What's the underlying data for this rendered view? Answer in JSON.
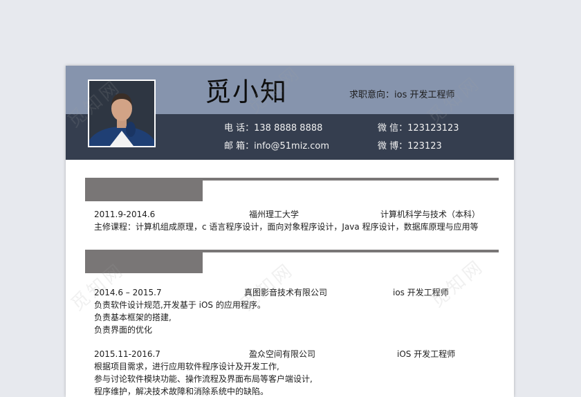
{
  "header": {
    "name": "觅小知",
    "job_intent": "求职意向：ios 开发工程师",
    "phone": "电  话：138 8888 8888",
    "email": "邮  箱：info@51miz.com",
    "wechat": "微  信：123123123",
    "weibo": "微  博：123123"
  },
  "education": {
    "period": "2011.9-2014.6",
    "school": "福州理工大学",
    "major": "计算机科学与技术（本科）",
    "courses": "主修课程：计算机组成原理，c 语言程序设计，面向对象程序设计，Java 程序设计，数据库原理与应用等"
  },
  "experience": [
    {
      "period": "2014.6  –  2015.7",
      "company": "真图影音技术有限公司",
      "position": "ios 开发工程师",
      "duties": [
        "负责软件设计规范,开发基于 iOS 的应用程序。",
        "负责基本框架的搭建,",
        "负责界面的优化"
      ]
    },
    {
      "period": "2015.11-2016.7",
      "company": "盈众空间有限公司",
      "position": "iOS 开发工程师",
      "duties": [
        "根据项目需求，进行应用软件程序设计及开发工作,",
        "参与讨论软件模块功能、操作流程及界面布局等客户端设计,",
        "程序维护，解决技术故障和消除系统中的缺陷。"
      ]
    }
  ],
  "watermark": "觅知网",
  "colors": {
    "header_top": "#8694ad",
    "header_bottom": "#353e4f",
    "section": "#797676"
  }
}
